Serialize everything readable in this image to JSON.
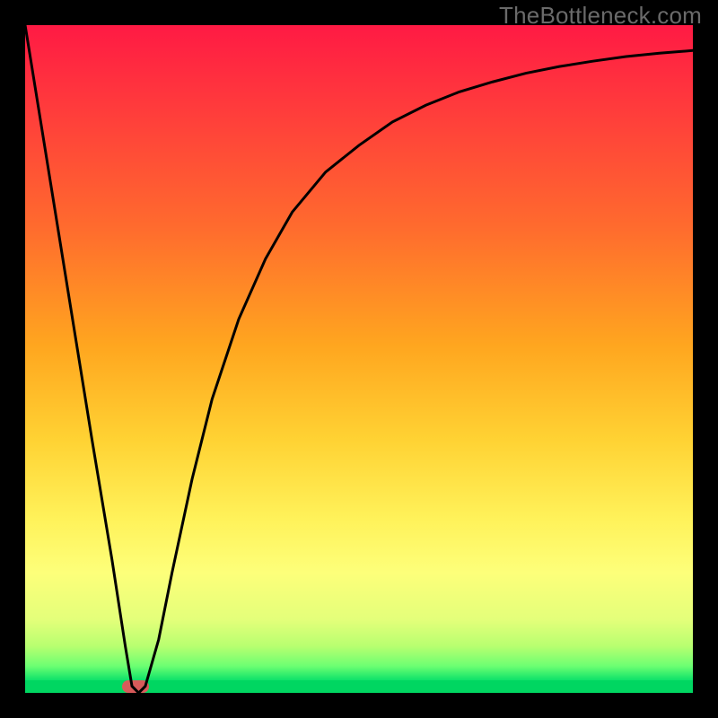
{
  "watermark": "TheBottleneck.com",
  "colors": {
    "background": "#000000",
    "gradient_top": "#ff1a44",
    "gradient_bottom": "#00d661",
    "curve": "#000000",
    "marker": "#d75a5a"
  },
  "chart_data": {
    "type": "line",
    "title": "",
    "xlabel": "",
    "ylabel": "",
    "xlim": [
      0,
      100
    ],
    "ylim": [
      0,
      100
    ],
    "grid": false,
    "legend": false,
    "annotations": [
      {
        "text": "TheBottleneck.com",
        "position": "top-right"
      }
    ],
    "series": [
      {
        "name": "bottleneck-curve",
        "x": [
          0,
          5,
          10,
          13,
          15,
          16,
          17,
          18,
          20,
          22,
          25,
          28,
          32,
          36,
          40,
          45,
          50,
          55,
          60,
          65,
          70,
          75,
          80,
          85,
          90,
          95,
          100
        ],
        "values": [
          100,
          69,
          38,
          20,
          7,
          1,
          0,
          1,
          8,
          18,
          32,
          44,
          56,
          65,
          72,
          78,
          82,
          85.5,
          88,
          90,
          91.5,
          92.8,
          93.8,
          94.6,
          95.3,
          95.8,
          96.2
        ]
      }
    ],
    "marker": {
      "x_range": [
        14.5,
        18.5
      ],
      "y": 0
    }
  }
}
